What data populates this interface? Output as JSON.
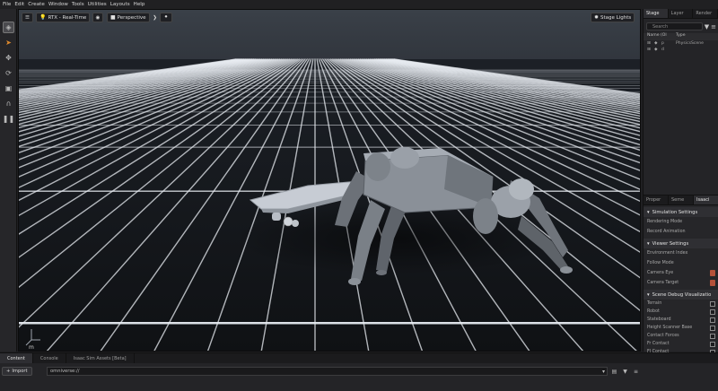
{
  "menu": [
    "File",
    "Edit",
    "Create",
    "Window",
    "Tools",
    "Utilities",
    "Layouts",
    "Help"
  ],
  "viewport_toolbar": {
    "renderer": "RTX - Real-Time",
    "camera": "Perspective",
    "stage_lights": "Stage Lights",
    "axis_label": "m"
  },
  "stage_panel": {
    "tabs": [
      "Stage",
      "Layer",
      "Render"
    ],
    "search_placeholder": "Search",
    "columns": [
      "Name (Ol",
      "Type"
    ],
    "rows": [
      {
        "name": "p",
        "type": "PhysicsScene"
      },
      {
        "name": "d",
        "type": ""
      }
    ]
  },
  "props_panel": {
    "tabs": [
      "Proper",
      "Seme",
      "Isaaci"
    ],
    "sections": [
      {
        "title": "Simulation Settings",
        "items": [
          "Rendering Mode",
          "Record Animation"
        ]
      },
      {
        "title": "Viewer Settings",
        "items": [
          "Environment Index",
          "Follow Mode",
          "Camera Eye",
          "Camera Target"
        ]
      },
      {
        "title": "Scene Debug Visualizatio",
        "items": [
          "Terrain",
          "Robot",
          "Stateboard",
          "Height Scanner Base",
          "Contact Forces",
          "Fr Contact",
          "Fl Contact"
        ]
      }
    ]
  },
  "bottom": {
    "tabs": [
      "Content",
      "Console",
      "Isaac Sim Assets [Beta]"
    ],
    "import_label": "Import",
    "path": "omniverse://"
  },
  "colors": {
    "viewport_bg": "#2a2e34",
    "grid": "#e8ecf2",
    "accent_swatch": "#b4513a"
  }
}
